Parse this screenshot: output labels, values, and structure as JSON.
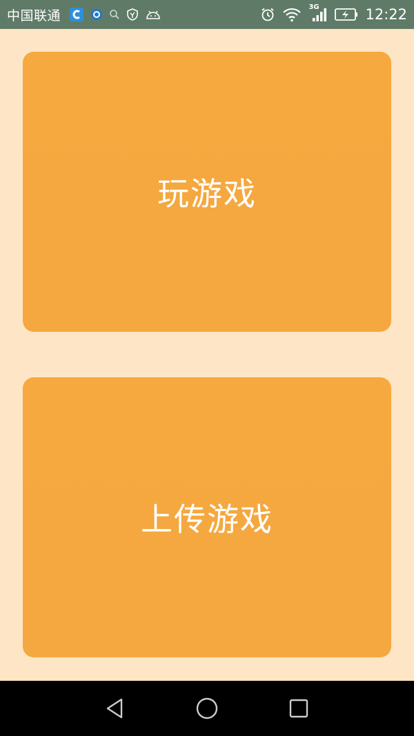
{
  "status_bar": {
    "carrier": "中国联通",
    "time": "12:22",
    "network_type": "3G",
    "left_icons": [
      "browser-app-icon",
      "app-notification-icon",
      "search-icon",
      "shield-icon",
      "android-icon"
    ],
    "right_icons": [
      "alarm-icon",
      "wifi-icon",
      "signal-icon",
      "battery-icon"
    ],
    "background": "#5F7B68"
  },
  "main": {
    "play_label": "玩游戏",
    "upload_label": "上传游戏",
    "button_color": "#F5A83E",
    "background": "#FDE5C5"
  },
  "nav_bar": {
    "icons": [
      "back-icon",
      "home-icon",
      "recent-apps-icon"
    ],
    "background": "#000000"
  }
}
